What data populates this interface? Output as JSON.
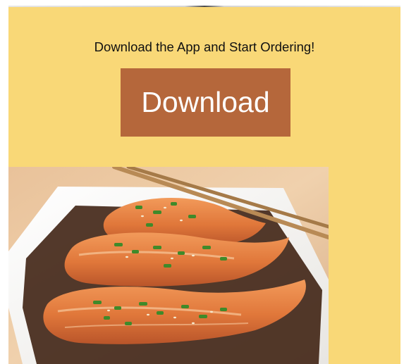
{
  "promo": {
    "headline": "Download the App and Start Ordering!",
    "download_label": "Download"
  },
  "image": {
    "subject": "salmon-dish-photo"
  },
  "colors": {
    "panel_background": "#f9d877",
    "button_background": "#b5673b",
    "button_text": "#ffffff",
    "headline_text": "#111111"
  }
}
